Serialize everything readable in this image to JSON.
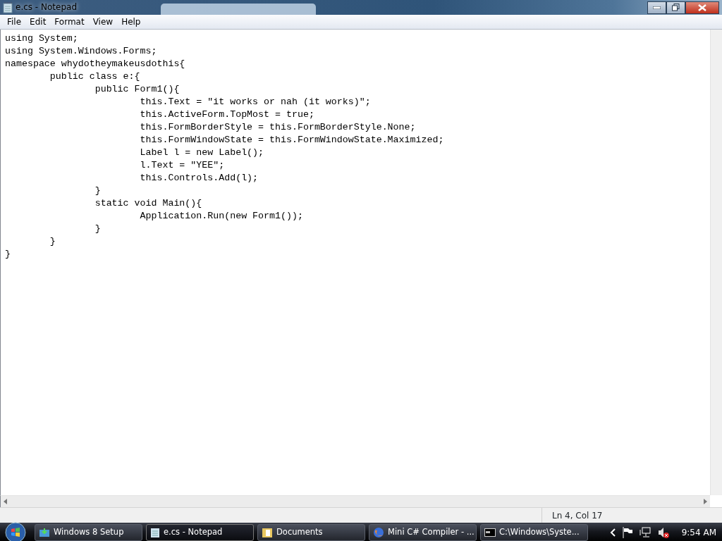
{
  "window": {
    "title": "e.cs - Notepad"
  },
  "menu": [
    {
      "label": "File"
    },
    {
      "label": "Edit"
    },
    {
      "label": "Format"
    },
    {
      "label": "View"
    },
    {
      "label": "Help"
    }
  ],
  "editor": {
    "lines": [
      "using System;",
      "using System.Windows.Forms;",
      "namespace whydotheymakeusdothis{",
      "\tpublic class e:{",
      "\t\tpublic Form1(){",
      "\t\t\tthis.Text = \"it works or nah (it works)\";",
      "\t\t\tthis.ActiveForm.TopMost = true;",
      "\t\t\tthis.FormBorderStyle = this.FormBorderStyle.None;",
      "\t\t\tthis.FormWindowState = this.FormWindowState.Maximized;",
      "\t\t\tLabel l = new Label();",
      "\t\t\tl.Text = \"YEE\";",
      "\t\t\tthis.Controls.Add(l);",
      "\t\t}",
      "\t\tstatic void Main(){",
      "\t\t\tApplication.Run(new Form1());",
      "\t\t}",
      "\t}",
      "}"
    ]
  },
  "status_bar": {
    "position": "Ln 4, Col 17"
  },
  "taskbar": {
    "items": [
      {
        "label": "Windows 8 Setup",
        "kind": "setup",
        "selected": false
      },
      {
        "label": "e.cs - Notepad",
        "kind": "notepad",
        "selected": true
      },
      {
        "label": "Documents",
        "kind": "folder",
        "selected": false
      },
      {
        "label": "Mini C# Compiler - ...",
        "kind": "browser",
        "selected": false
      },
      {
        "label": "C:\\Windows\\Syste...",
        "kind": "console",
        "selected": false
      }
    ],
    "clock": "9:54 AM"
  }
}
